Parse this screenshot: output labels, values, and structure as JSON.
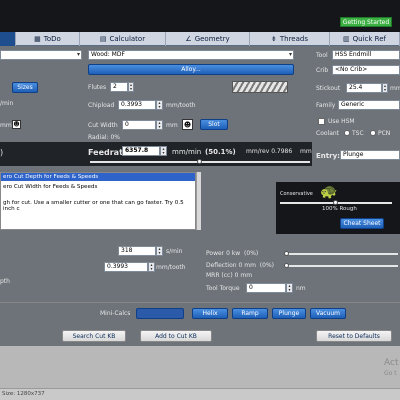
{
  "getting_started": "Getting Started",
  "tabs": [
    {
      "label": "ToDo",
      "icon": "▦"
    },
    {
      "label": "Calculator",
      "icon": "▤"
    },
    {
      "label": "Geometry",
      "icon": "∠"
    },
    {
      "label": "Threads",
      "icon": "⇟"
    },
    {
      "label": "Quick Ref",
      "icon": "▥"
    }
  ],
  "left": {
    "sizes_button": "Sizes",
    "rpm_unit": "/min",
    "unit_mm": "mm"
  },
  "material": {
    "value": "Wood: MDF",
    "alloy_button": "Alloy..."
  },
  "flutes": {
    "label": "Flutes",
    "value": "2"
  },
  "chipload": {
    "label": "Chipload",
    "value": "0.3993",
    "unit": "mm/tooth"
  },
  "cut_width": {
    "label": "Cut Width",
    "value": "0",
    "unit": "mm",
    "slot_button": "Slot",
    "radial_label": "Radial: 0%"
  },
  "feedrate": {
    "label": "Feedrate",
    "value": "6357.8",
    "unit": "mm/min",
    "percent": "(50.1%)",
    "rev_text": "mm/rev 0.7986",
    "rev_unit": "mm",
    "slider_level": 0.5
  },
  "tool": {
    "tool_label": "Tool",
    "tool_value": "HSS Endmill",
    "crib_label": "Crib",
    "crib_value": "<No Crib>",
    "stickout_label": "Stickout",
    "stickout_value": "25.4",
    "stickout_unit": "mm",
    "family_label": "Family",
    "family_value": "Generic",
    "use_hsm_label": "Use HSM",
    "coolant_label": "Coolant",
    "tsc_label": "TSC",
    "pcn_label": "PCN",
    "entry_label": "Entry:",
    "entry_value": "Plunge"
  },
  "notes": {
    "line1": "ero Cut Depth for Feeds & Speeds",
    "line2": "ero Cut Width for Feeds & Speeds",
    "line3": "gh for cut.  Use a smaller cutter or one that can go faster. Try 0.5 inch c"
  },
  "tuning": {
    "conservative_label": "Conservative",
    "rough_label": "100% Rough",
    "cheat_sheet_button": "Cheat Sheet",
    "level": 0.5
  },
  "lower": {
    "rpm_value": "318",
    "rpm_unit": "s/min",
    "chip_value": "0.3993",
    "chip_unit": "mm/tooth",
    "depth_label": "pth"
  },
  "power": {
    "power_label": "Power",
    "power_value": "0",
    "power_unit": "kw",
    "power_pct": "(0%)",
    "deflection_label": "Deflection",
    "deflection_value": "0",
    "deflection_unit": "mm",
    "deflection_pct": "(0%)",
    "mrr_label": "MRR (cc)",
    "mrr_value": "0",
    "mrr_unit": "mm",
    "torque_label": "Tool Torque",
    "torque_value": "0",
    "torque_unit": "nm"
  },
  "mini_calcs": {
    "label": "Mini-Calcs",
    "buttons": [
      "Helix",
      "Ramp",
      "Plunge",
      "Vacuum"
    ]
  },
  "bottom_buttons": {
    "search": "Search Cut KB",
    "add": "Add to Cut KB",
    "reset": "Reset to Defaults"
  },
  "watermark": {
    "line1": "Act",
    "line2": "Go t"
  },
  "status": {
    "size_text": "Size: 1280x737"
  }
}
